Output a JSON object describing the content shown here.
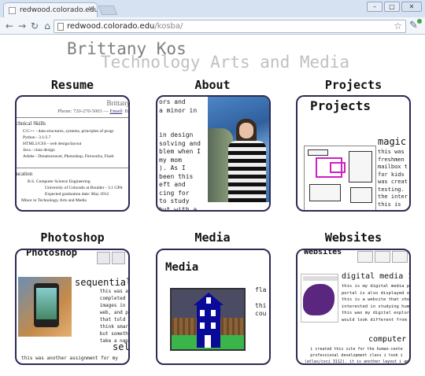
{
  "browser": {
    "tab_title": "redwood.colorado.edu/ko",
    "tab_close": "✕",
    "url_host": "redwood.colorado.edu",
    "url_path": "/kosba/",
    "win_min": "–",
    "win_max": "□",
    "win_close": "✕",
    "back": "←",
    "forward": "→",
    "reload": "↻",
    "home": "⌂",
    "star": "☆",
    "wrench": "🔧"
  },
  "header": {
    "name": "Brittany Kos",
    "subtitle": "Technology Arts and Media"
  },
  "sections": {
    "resume": "Resume",
    "about": "About",
    "projects": "Projects",
    "photoshop": "Photoshop",
    "media": "Media",
    "websites": "Websites"
  },
  "resume_card": {
    "name": "Brittany",
    "phone_prefix": "Phone: 720-270-5003 — ",
    "email_label": "Email",
    "phone_suffix": ": Br",
    "skills_heading": "echnical Skills",
    "skills": [
      "C/C++ - data structures, systems, principles of progr",
      "Python - 3.1/2.7",
      "HTML5/CSS - web design/layout",
      "Java - class design",
      "Adobe - Dreamweaver, Photoshop, Fireworks, Flash"
    ],
    "edu_heading": "ducation",
    "edu_lines": [
      "B.S. Computer Science Engineering",
      "University of Colorado at Boulder - 3.1 GPA",
      "Expected graduation date: May 2012",
      "Minor in Technology, Arts and Media"
    ]
  },
  "about_card": {
    "text": "ors and\na minor in\n\n\nin design\nsolving and\nblem when I\nmy mom\n). As I\nbeen this\neft and\ncing for\nto study\nbut with a"
  },
  "projects_card": {
    "title": "Projects",
    "magic": "magic",
    "text": "this was\nfreshmen\nmailbox t\nfor kids\nwas creat\ntesting.\nthe inter\nthis is"
  },
  "photoshop_card": {
    "title": "Photoshop",
    "sequential": "sequential",
    "text": "                this was an assign\n                completed recently\n                images in photosho\n                web, and pictures\n                that told a story.\n                think smart phones\n                but somethings we\n                take a nap) or ev",
    "sel": "sel",
    "bottom": "this was another assignment for my"
  },
  "media_card": {
    "title": "Media",
    "side": "fla\n\nthi\ncou"
  },
  "websites_card": {
    "title": "Websites",
    "dm": "digital media 1",
    "text": "this is my digital media po\nportal is also displayed on\nthis is a website that shows\ninterested in studying huma\nthis was my digital explora\nwould look different from c",
    "cs": "computer s",
    "bottom": "i created this site for the human-cente\nprofessional development class i took i\n(atlas/csci 3112). it is another layout i am"
  }
}
